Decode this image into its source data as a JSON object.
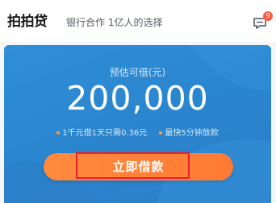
{
  "header": {
    "logo_text": "拍拍贷",
    "slogan": "银行合作 1亿人的选择",
    "message_icon": "chat-bubble-icon",
    "message_badge": "9"
  },
  "card": {
    "estimate_label": "预估可借(元)",
    "amount": "200,000",
    "features": [
      "1千元借1天只需0.36元",
      "最快5分钟放款"
    ],
    "apply_button_label": "立即借款"
  },
  "colors": {
    "card_blue": "#2f8fd6",
    "button_orange": "#ff7a33",
    "highlight_red": "#e8202a",
    "badge_red": "#ff5a3d",
    "bullet_orange": "#ff9a3c"
  }
}
